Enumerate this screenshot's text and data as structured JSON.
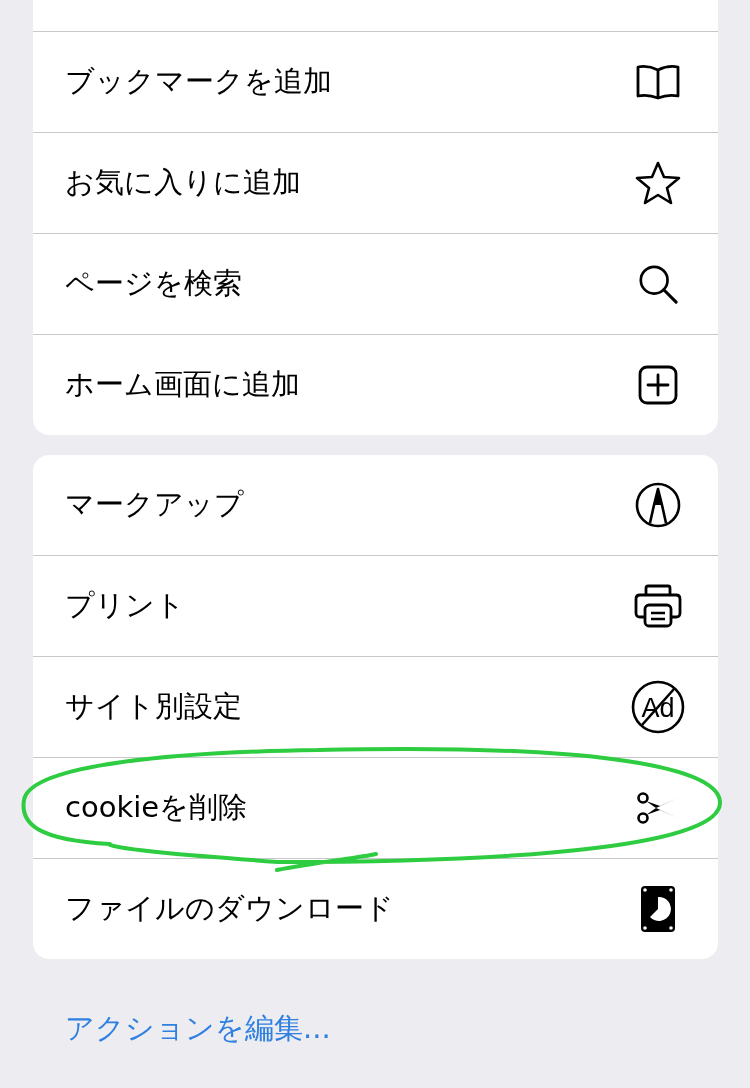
{
  "groups": [
    {
      "cut_top": true,
      "items": [
        {
          "label": "ブックマークを追加",
          "kind": "book",
          "circled": false
        },
        {
          "label": "お気に入りに追加",
          "kind": "star",
          "circled": false
        },
        {
          "label": "ページを検索",
          "kind": "search",
          "circled": false
        },
        {
          "label": "ホーム画面に追加",
          "kind": "plus",
          "circled": false
        }
      ]
    },
    {
      "cut_top": false,
      "items": [
        {
          "label": "マークアップ",
          "kind": "markup",
          "circled": false
        },
        {
          "label": "プリント",
          "kind": "print",
          "circled": false
        },
        {
          "label": "サイト別設定",
          "kind": "settings",
          "icon_text": "Ad",
          "circled": false
        },
        {
          "label": "cookieを削除",
          "kind": "cut",
          "circled": true
        },
        {
          "label": "ファイルのダウンロード",
          "kind": "download",
          "circled": false
        }
      ]
    }
  ],
  "edit_link": "アクションを編集..."
}
